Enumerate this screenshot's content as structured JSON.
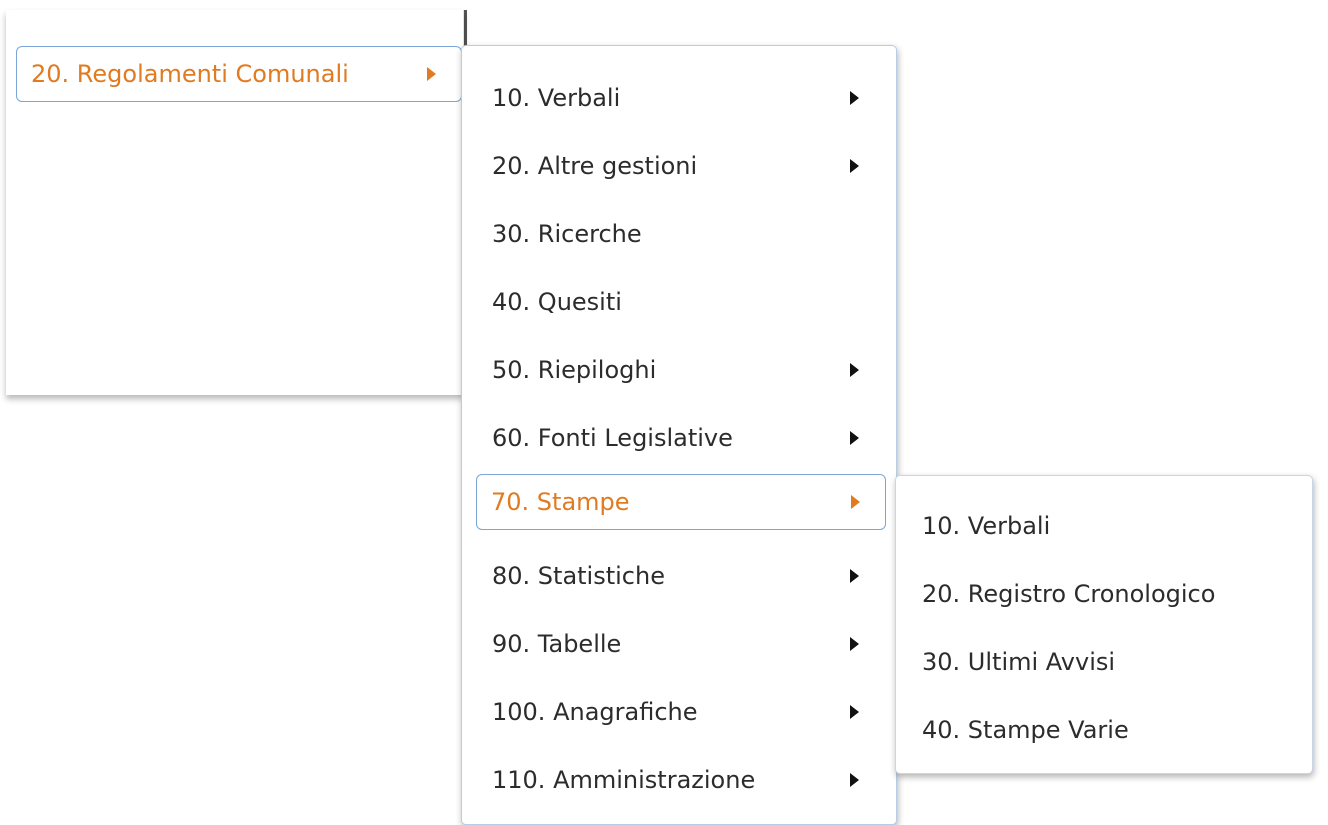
{
  "menu_level_1": {
    "items": [
      {
        "label": "20. Regolamenti Comunali",
        "has_submenu": true,
        "selected": true
      }
    ]
  },
  "menu_level_2": {
    "items": [
      {
        "label": "10. Verbali",
        "has_submenu": true
      },
      {
        "label": "20. Altre gestioni",
        "has_submenu": true
      },
      {
        "label": "30. Ricerche",
        "has_submenu": false
      },
      {
        "label": "40. Quesiti",
        "has_submenu": false
      },
      {
        "label": "50. Riepiloghi",
        "has_submenu": true
      },
      {
        "label": "60. Fonti Legislative",
        "has_submenu": true
      },
      {
        "label": "70. Stampe",
        "has_submenu": true,
        "selected": true
      },
      {
        "label": "80. Statistiche",
        "has_submenu": true
      },
      {
        "label": "90. Tabelle",
        "has_submenu": true
      },
      {
        "label": "100. Anagrafiche",
        "has_submenu": true
      },
      {
        "label": "110. Amministrazione",
        "has_submenu": true
      }
    ]
  },
  "menu_level_3": {
    "items": [
      {
        "label": "10. Verbali",
        "has_submenu": false
      },
      {
        "label": "20. Registro Cronologico",
        "has_submenu": false
      },
      {
        "label": "30. Ultimi Avvisi",
        "has_submenu": false
      },
      {
        "label": "40. Stampe Varie",
        "has_submenu": false
      }
    ]
  },
  "colors": {
    "selected_text": "#e07b22",
    "selected_border": "#7aa6d8",
    "default_text": "#2c2c2c",
    "arrow": "#111111"
  }
}
